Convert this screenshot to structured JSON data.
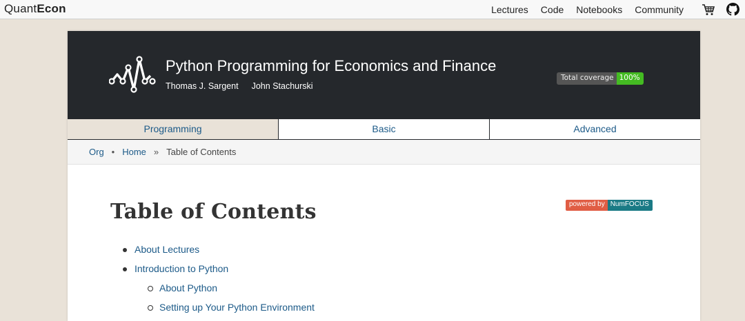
{
  "brand": {
    "part1": "Quant",
    "part2": "Econ"
  },
  "topnav": {
    "items": [
      "Lectures",
      "Code",
      "Notebooks",
      "Community"
    ]
  },
  "icons": {
    "cart": "cart-icon",
    "github": "github-icon",
    "logo": "quantecon-logo"
  },
  "header": {
    "title": "Python Programming for Economics and Finance",
    "authors": [
      "Thomas J. Sargent",
      "John Stachurski"
    ],
    "coverage_label": "Total coverage",
    "coverage_value": "100%"
  },
  "tabs": [
    {
      "label": "Programming",
      "active": true
    },
    {
      "label": "Basic",
      "active": false
    },
    {
      "label": "Advanced",
      "active": false
    }
  ],
  "breadcrumb": {
    "items": [
      "Org",
      "Home",
      "Table of Contents"
    ],
    "separators": [
      "•",
      "»"
    ]
  },
  "content": {
    "title": "Table of Contents",
    "badge_left": "powered by",
    "badge_right": "NumFOCUS",
    "toc": [
      {
        "label": "About Lectures",
        "level": 1
      },
      {
        "label": "Introduction to Python",
        "level": 1
      },
      {
        "label": "About Python",
        "level": 2
      },
      {
        "label": "Setting up Your Python Environment",
        "level": 2
      }
    ]
  },
  "colors": {
    "page_bg": "#e9e2d8",
    "header_bg": "#25282c",
    "link": "#1c5a88",
    "coverage_green": "#44bb22",
    "numfocus_red": "#e05d44",
    "numfocus_teal": "#1a7a85"
  }
}
